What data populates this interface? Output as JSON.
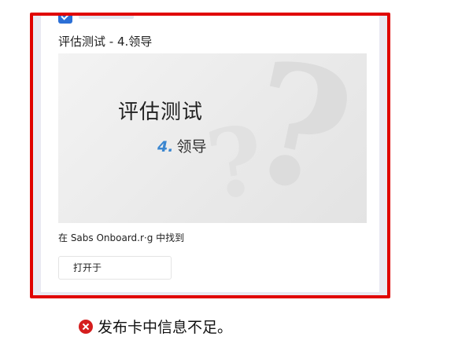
{
  "card": {
    "title": "评估测试 - 4.领导",
    "hero": {
      "title": "评估测试",
      "number": "4.",
      "subtitle": "领导"
    },
    "found_in": "在 Sabs Onboard.r·g 中找到",
    "open_button": "打开于"
  },
  "status": {
    "icon": "error-x-icon",
    "message": "发布卡中信息不足。",
    "color": "#d51d1d"
  },
  "colors": {
    "frame_border": "#e00000",
    "accent_number": "#3a86d0"
  }
}
